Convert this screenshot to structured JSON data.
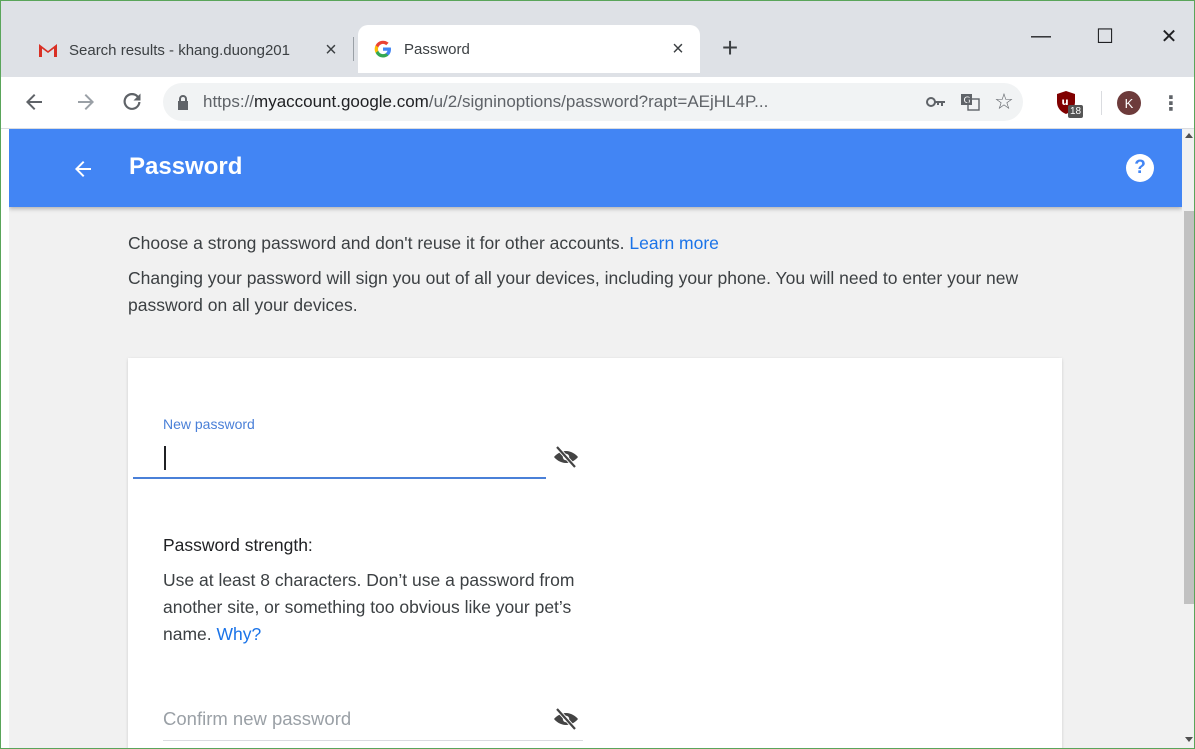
{
  "browser": {
    "tabs": [
      {
        "label": "Search results - khang.duong201",
        "icon": "gmail-icon",
        "close": "×"
      },
      {
        "label": "Password",
        "icon": "google-g-icon",
        "close": "×"
      }
    ],
    "new_tab": "+",
    "window_controls": {
      "minimize": "—",
      "maximize": "☐",
      "close": "✕"
    },
    "url_scheme": "https://",
    "url_host": "myaccount.google.com",
    "url_path": "/u/2/signinoptions/password?rapt=AEjHL4P...",
    "extension_badge": "18",
    "profile_initial": "K",
    "colors": {
      "tabstrip": "#dee1e6",
      "accent": "#4285f4",
      "link": "#1a73e8"
    }
  },
  "page": {
    "title": "Password",
    "help_label": "?",
    "intro_line1": "Choose a strong password and don't reuse it for other accounts.",
    "learn_more": "Learn more",
    "intro_line2": "Changing your password will sign you out of all your devices, including your phone. You will need to enter your new password on all your devices.",
    "new_password_label": "New password",
    "new_password_value": "",
    "strength_title": "Password strength:",
    "strength_text": "Use at least 8 characters. Don’t use a password from another site, or something too obvious like your pet’s name.",
    "why_link": "Why?",
    "confirm_placeholder": "Confirm new password"
  }
}
